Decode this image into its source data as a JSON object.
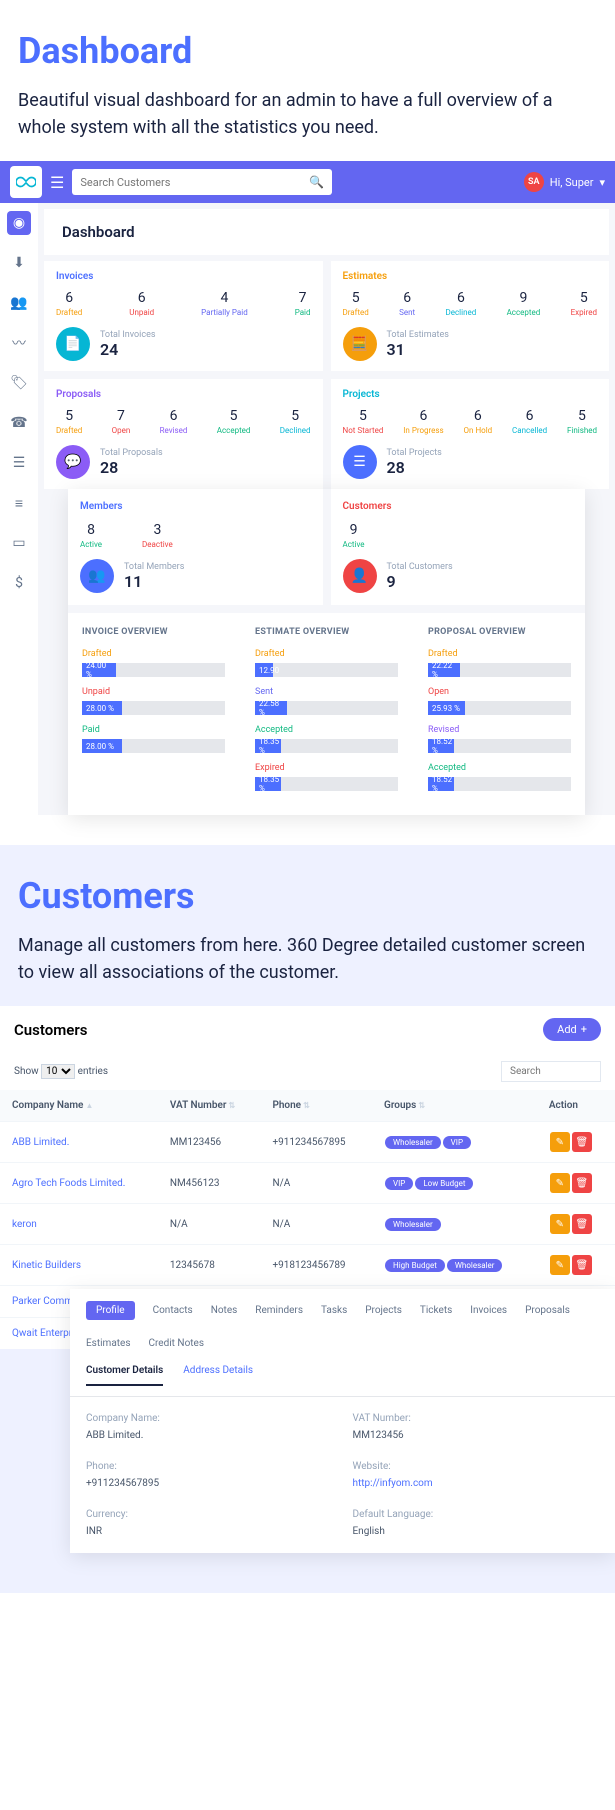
{
  "section1": {
    "title": "Dashboard",
    "desc": "Beautiful visual dashboard for an admin to have a full overview of a whole system with all the statistics you need."
  },
  "topbar": {
    "search_placeholder": "Search Customers",
    "user_initials": "SA",
    "user_greeting": "Hi, Super"
  },
  "page_title": "Dashboard",
  "invoices": {
    "title": "Invoices",
    "stats": [
      {
        "v": "6",
        "l": "Drafted"
      },
      {
        "v": "6",
        "l": "Unpaid"
      },
      {
        "v": "4",
        "l": "Partially Paid"
      },
      {
        "v": "7",
        "l": "Paid"
      }
    ],
    "total_label": "Total Invoices",
    "total": "24"
  },
  "estimates": {
    "title": "Estimates",
    "stats": [
      {
        "v": "5",
        "l": "Drafted"
      },
      {
        "v": "6",
        "l": "Sent"
      },
      {
        "v": "6",
        "l": "Declined"
      },
      {
        "v": "9",
        "l": "Accepted"
      },
      {
        "v": "5",
        "l": "Expired"
      }
    ],
    "total_label": "Total Estimates",
    "total": "31"
  },
  "proposals": {
    "title": "Proposals",
    "stats": [
      {
        "v": "5",
        "l": "Drafted"
      },
      {
        "v": "7",
        "l": "Open"
      },
      {
        "v": "6",
        "l": "Revised"
      },
      {
        "v": "5",
        "l": "Accepted"
      },
      {
        "v": "5",
        "l": "Declined"
      }
    ],
    "total_label": "Total Proposals",
    "total": "28"
  },
  "projects": {
    "title": "Projects",
    "stats": [
      {
        "v": "5",
        "l": "Not Started"
      },
      {
        "v": "6",
        "l": "In Progress"
      },
      {
        "v": "6",
        "l": "On Hold"
      },
      {
        "v": "6",
        "l": "Cancelled"
      },
      {
        "v": "5",
        "l": "Finished"
      }
    ],
    "total_label": "Total Projects",
    "total": "28"
  },
  "members": {
    "title": "Members",
    "stats": [
      {
        "v": "8",
        "l": "Active"
      },
      {
        "v": "3",
        "l": "Deactive"
      }
    ],
    "total_label": "Total Members",
    "total": "11"
  },
  "customers_card": {
    "title": "Customers",
    "stats": [
      {
        "v": "9",
        "l": "Active"
      }
    ],
    "total_label": "Total Customers",
    "total": "9"
  },
  "overview": {
    "invoice": {
      "title": "INVOICE OVERVIEW",
      "items": [
        {
          "l": "Drafted",
          "p": "24.00 %",
          "c": "c-draft"
        },
        {
          "l": "Unpaid",
          "p": "28.00 %",
          "c": "c-unpaid"
        },
        {
          "l": "Paid",
          "p": "28.00 %",
          "c": "c-paid"
        }
      ]
    },
    "estimate": {
      "title": "ESTIMATE OVERVIEW",
      "items": [
        {
          "l": "Drafted",
          "p": "12.90",
          "c": "c-draft"
        },
        {
          "l": "Sent",
          "p": "22.58 %",
          "c": "c-sent"
        },
        {
          "l": "Accepted",
          "p": "18.35 %",
          "c": "c-accept"
        },
        {
          "l": "Expired",
          "p": "18.35 %",
          "c": "c-exp"
        }
      ]
    },
    "proposal": {
      "title": "PROPOSAL OVERVIEW",
      "items": [
        {
          "l": "Drafted",
          "p": "22.22 %",
          "c": "c-draft"
        },
        {
          "l": "Open",
          "p": "25.93 %",
          "c": "c-open"
        },
        {
          "l": "Revised",
          "p": "18.52 %",
          "c": "c-rev"
        },
        {
          "l": "Accepted",
          "p": "18.52 %",
          "c": "c-accept"
        }
      ]
    }
  },
  "section2": {
    "title": "Customers",
    "desc": "Manage all customers from here. 360 Degree detailed customer screen to view all associations of the customer."
  },
  "cust": {
    "heading": "Customers",
    "add": "Add",
    "show": "Show",
    "entries": "entries",
    "per": "10",
    "search_placeholder": "Search",
    "cols": {
      "name": "Company Name",
      "vat": "VAT Number",
      "phone": "Phone",
      "groups": "Groups",
      "action": "Action"
    },
    "rows": [
      {
        "name": "ABB Limited.",
        "vat": "MM123456",
        "phone": "+911234567895",
        "groups": [
          "Wholesaler",
          "VIP"
        ]
      },
      {
        "name": "Agro Tech Foods Limited.",
        "vat": "NM456123",
        "phone": "N/A",
        "groups": [
          "VIP",
          "Low Budget"
        ]
      },
      {
        "name": "keron",
        "vat": "N/A",
        "phone": "N/A",
        "groups": [
          "Wholesaler"
        ]
      },
      {
        "name": "Kinetic Builders",
        "vat": "12345678",
        "phone": "+918123456789",
        "groups": [
          "High Budget",
          "Wholesaler"
        ]
      },
      {
        "name": "Parker Commun",
        "vat": "",
        "phone": "",
        "groups": []
      },
      {
        "name": "Qwait Enterprises",
        "vat": "",
        "phone": "",
        "groups": []
      }
    ]
  },
  "detail": {
    "tabs": [
      "Profile",
      "Contacts",
      "Notes",
      "Reminders",
      "Tasks",
      "Projects",
      "Tickets",
      "Invoices",
      "Proposals",
      "Estimates",
      "Credit Notes"
    ],
    "subtabs": [
      "Customer Details",
      "Address Details"
    ],
    "fields": {
      "company_l": "Company Name:",
      "company_v": "ABB Limited.",
      "vat_l": "VAT Number:",
      "vat_v": "MM123456",
      "phone_l": "Phone:",
      "phone_v": "+911234567895",
      "website_l": "Website:",
      "website_v": "http://infyom.com",
      "currency_l": "Currency:",
      "currency_v": "INR",
      "lang_l": "Default Language:",
      "lang_v": "English"
    }
  }
}
